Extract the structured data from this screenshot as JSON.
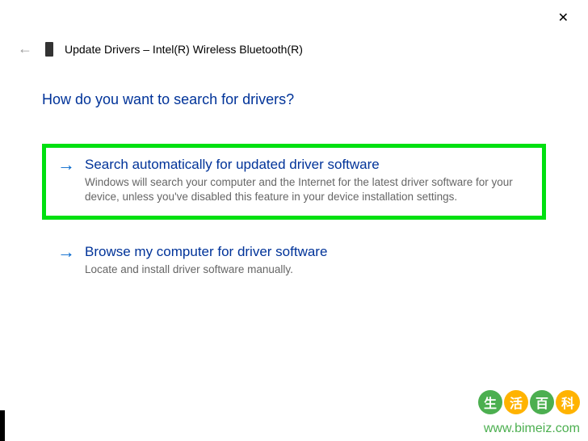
{
  "close_label": "✕",
  "header": {
    "back_arrow": "←",
    "title": "Update Drivers – Intel(R) Wireless Bluetooth(R)"
  },
  "question": "How do you want to search for drivers?",
  "options": [
    {
      "arrow": "→",
      "title": "Search automatically for updated driver software",
      "desc": "Windows will search your computer and the Internet for the latest driver software for your device, unless you've disabled this feature in your device installation settings."
    },
    {
      "arrow": "→",
      "title": "Browse my computer for driver software",
      "desc": "Locate and install driver software manually."
    }
  ],
  "watermark": {
    "chars": [
      "生",
      "活",
      "百",
      "科"
    ],
    "url": "www.bimeiz.com"
  }
}
